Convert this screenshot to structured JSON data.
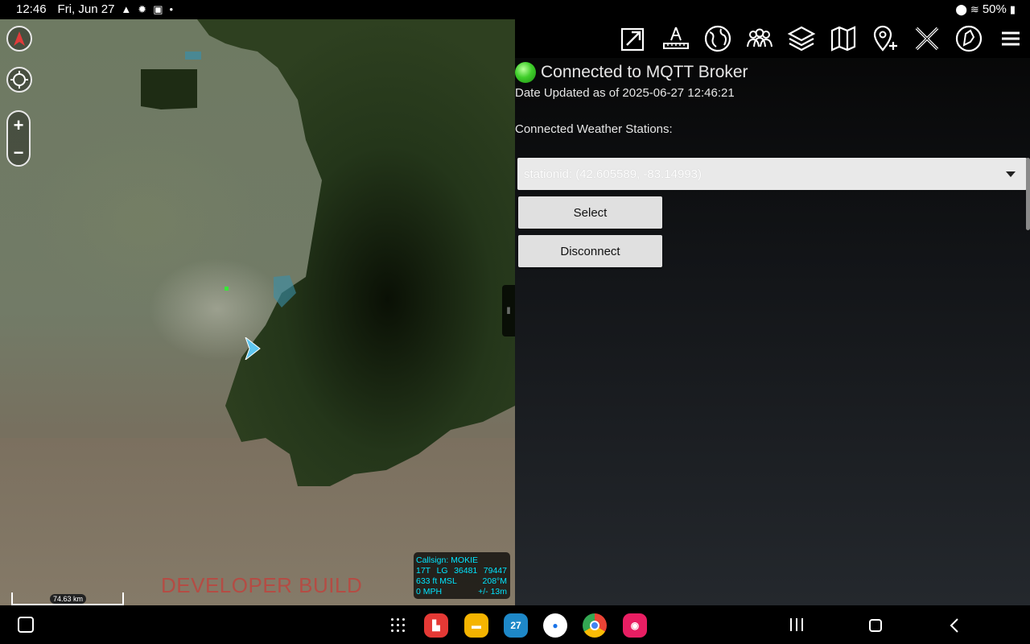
{
  "status_bar": {
    "time": "12:46",
    "date": "Fri, Jun 27",
    "battery": "50%"
  },
  "map": {
    "watermark": "DEVELOPER BUILD",
    "scale_label": "74.63 km",
    "zoom_in": "+",
    "zoom_out": "−",
    "info": {
      "callsign": "Callsign: MOKIE",
      "grid_zone": "17T",
      "grid_square": "LG",
      "easting": "36481",
      "northing": "79447",
      "altitude": "633 ft MSL",
      "heading": "208°M",
      "speed": "0 MPH",
      "accuracy": "+/- 13m"
    }
  },
  "panel": {
    "connection_status": "Connected to MQTT Broker",
    "date_updated": "Date Updated as of 2025-06-27 12:46:21",
    "stations_label": "Connected Weather Stations:",
    "selected_station": "stationid: (42.605589, -83.14993)",
    "select_button": "Select",
    "disconnect_button": "Disconnect"
  },
  "toolbar": {
    "icons": [
      "export-icon",
      "ruler-icon",
      "globe-icon",
      "contacts-icon",
      "layers-icon",
      "map-icon",
      "add-marker-icon",
      "close-x-icon",
      "plugin-icon",
      "menu-icon"
    ]
  },
  "navbar": {
    "calendar_day": "27"
  },
  "colors": {
    "connected": "#3fce2a",
    "info_text": "#00e5ff",
    "watermark": "#dc2828"
  }
}
